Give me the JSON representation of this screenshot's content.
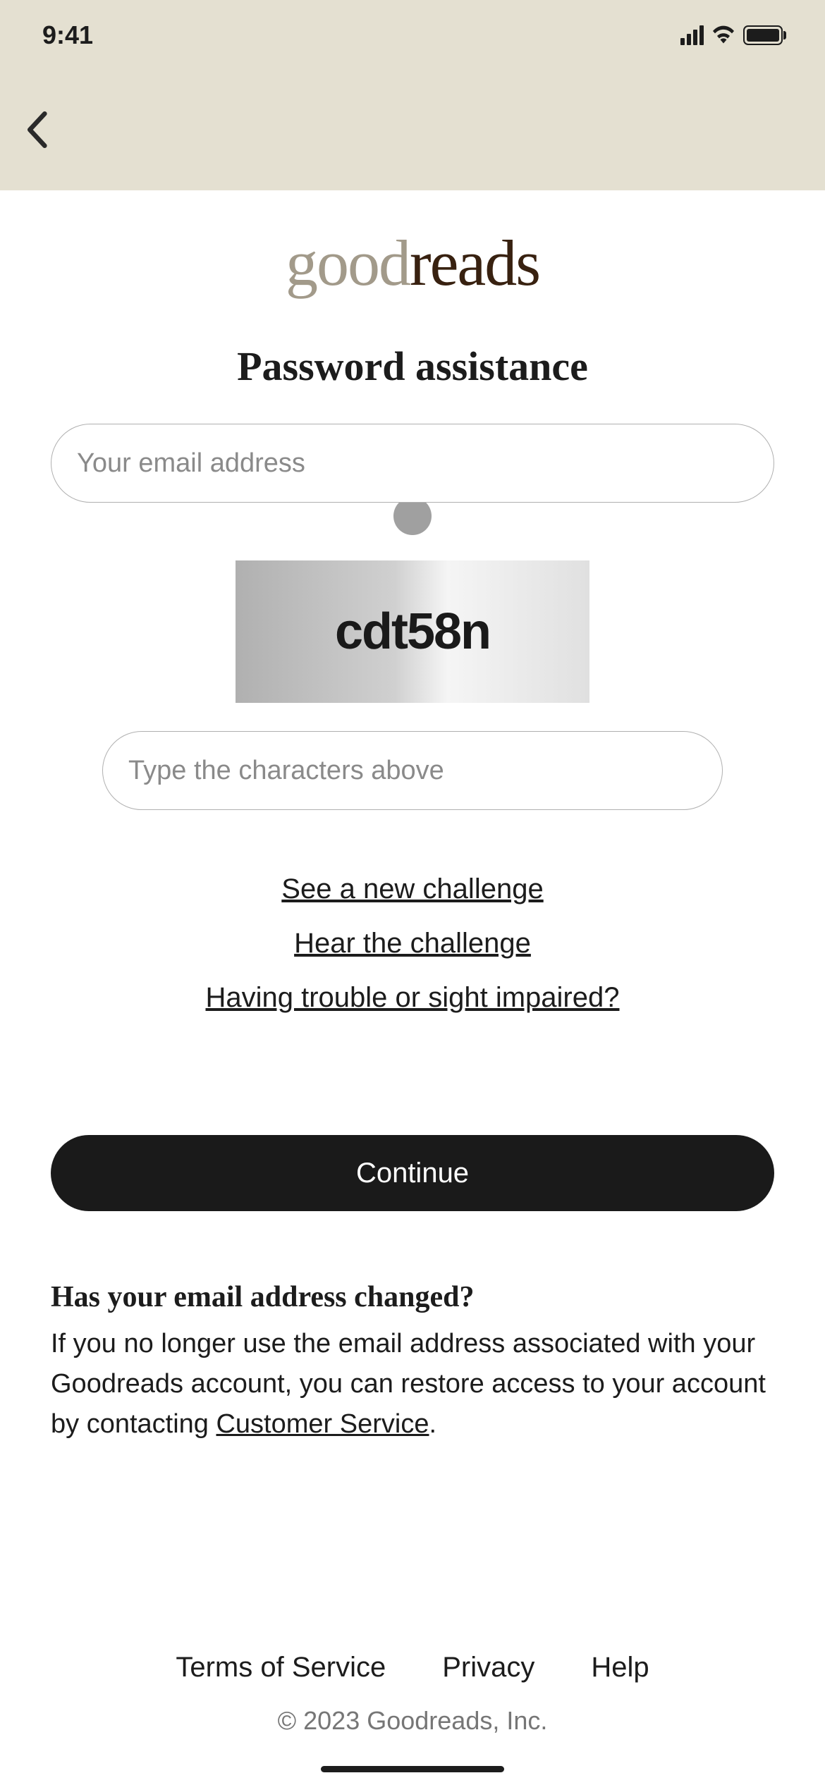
{
  "status": {
    "time": "9:41"
  },
  "logo": {
    "part1": "good",
    "part2": "reads"
  },
  "page": {
    "title": "Password assistance"
  },
  "form": {
    "email_placeholder": "Your email address",
    "captcha_text": "cdt58n",
    "captcha_placeholder": "Type the characters above",
    "continue_label": "Continue"
  },
  "challenge": {
    "new_challenge": "See a new challenge",
    "hear_challenge": "Hear the challenge",
    "trouble_link": "Having trouble or sight impaired?"
  },
  "changed": {
    "title": "Has your email address changed?",
    "body_pre": "If you no longer use the email address associated with your Goodreads account, you can restore access to your account by contacting ",
    "cs_link": "Customer Service",
    "body_post": "."
  },
  "footer": {
    "tos": "Terms of Service",
    "privacy": "Privacy",
    "help": "Help",
    "copyright": "© 2023 Goodreads, Inc."
  }
}
